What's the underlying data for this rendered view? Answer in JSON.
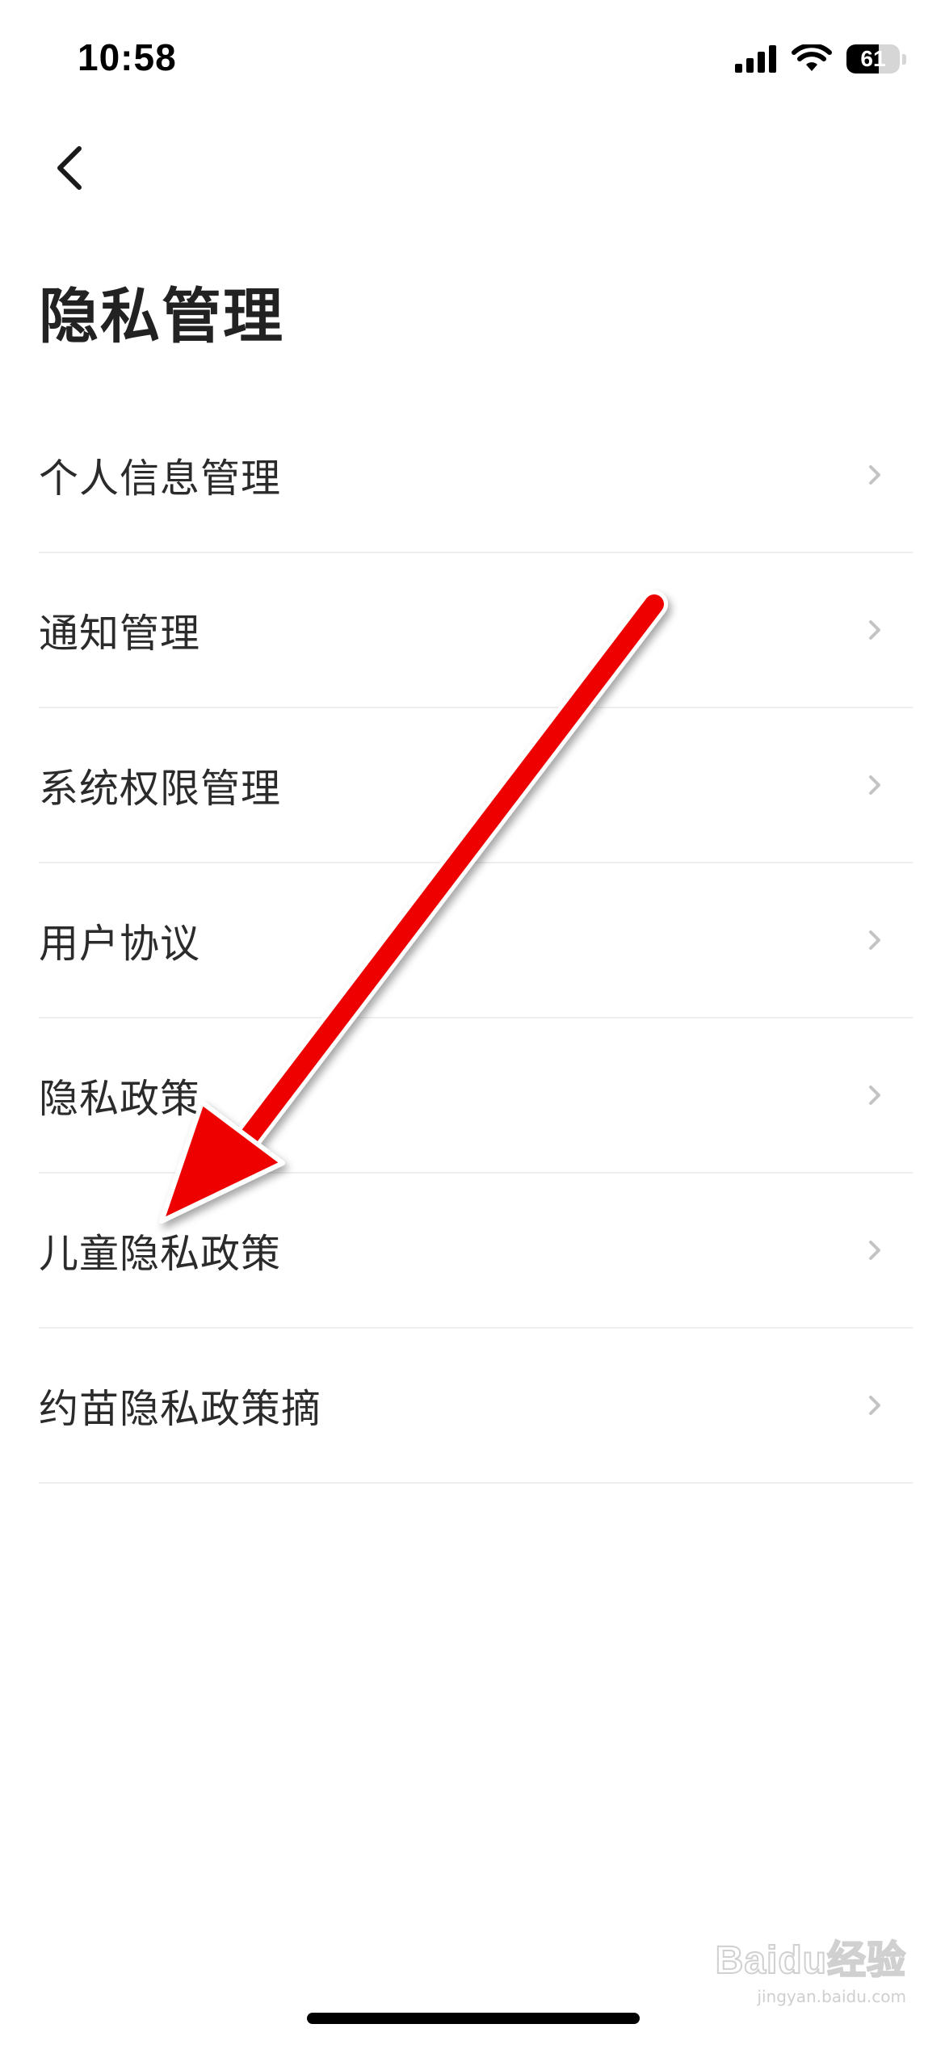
{
  "status_bar": {
    "time": "10:58",
    "battery_level": "61",
    "battery_fraction": 0.61
  },
  "header": {
    "back_icon": "chevron-left-icon",
    "title": "隐私管理"
  },
  "menu": {
    "items": [
      {
        "label": "个人信息管理"
      },
      {
        "label": "通知管理"
      },
      {
        "label": "系统权限管理"
      },
      {
        "label": "用户协议"
      },
      {
        "label": "隐私政策"
      },
      {
        "label": "儿童隐私政策"
      },
      {
        "label": "约苗隐私政策摘"
      }
    ],
    "chevron_icon": "chevron-right-icon"
  },
  "annotation": {
    "color": "#ee0000",
    "points_to": "儿童隐私政策"
  },
  "watermark": {
    "brand": "Baidu经验",
    "url": "jingyan.baidu.com"
  },
  "colors": {
    "background": "#ffffff",
    "text": "#2b2b2b",
    "divider": "#efefef",
    "chevron": "#c4c4c4"
  }
}
